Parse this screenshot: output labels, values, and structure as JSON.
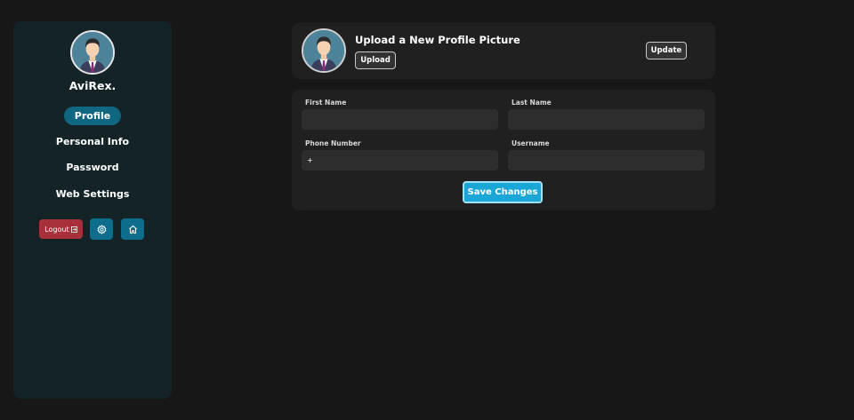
{
  "sidebar": {
    "user_name": "AviRex.",
    "nav": [
      {
        "label": "Profile",
        "active": true
      },
      {
        "label": "Personal Info",
        "active": false
      },
      {
        "label": "Password",
        "active": false
      },
      {
        "label": "Web Settings",
        "active": false
      }
    ],
    "logout_label": "Logout",
    "logout_icon": "logout-icon",
    "settings_icon": "gear-icon",
    "home_icon": "home-icon"
  },
  "upload_card": {
    "title": "Upload a New Profile Picture",
    "upload_label": "Upload",
    "update_label": "Update"
  },
  "form": {
    "first_name": {
      "label": "First Name",
      "value": ""
    },
    "last_name": {
      "label": "Last Name",
      "value": ""
    },
    "phone": {
      "label": "Phone Number",
      "value": "+"
    },
    "username": {
      "label": "Username",
      "value": ""
    },
    "save_label": "Save Changes"
  },
  "colors": {
    "background": "#171717",
    "sidebar": "#132326",
    "card": "#202020",
    "accent": "#0f6782",
    "save": "#1aa6d6",
    "logout": "#a8303a"
  }
}
